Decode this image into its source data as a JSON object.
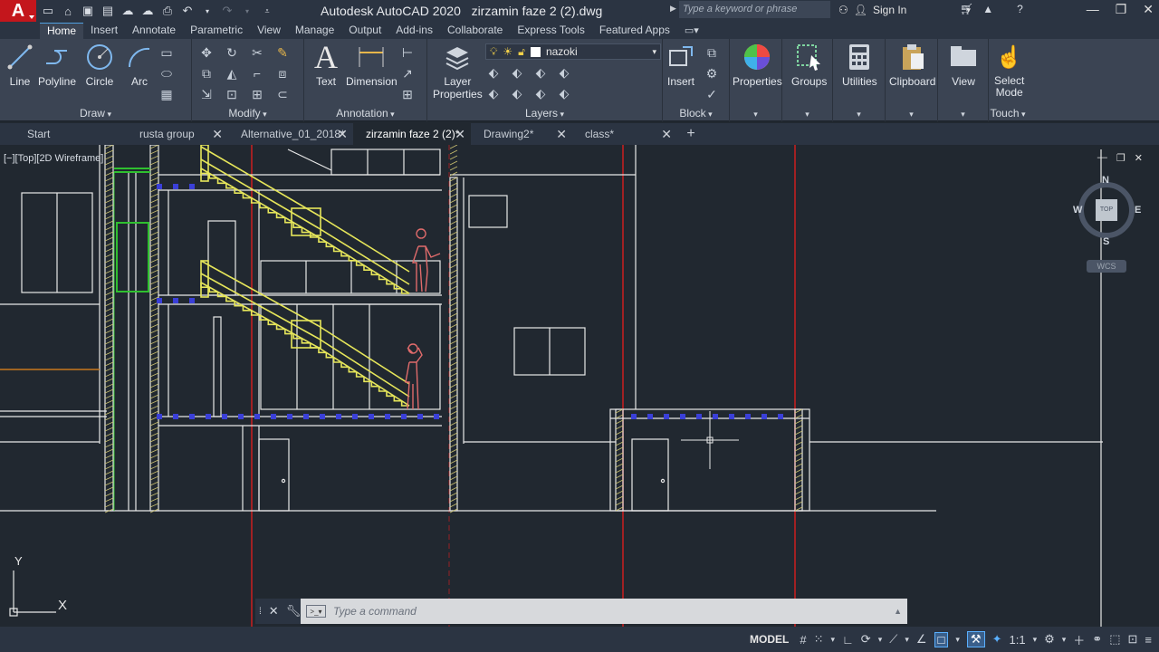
{
  "app": {
    "logo_letter": "A",
    "title": "Autodesk AutoCAD 2020",
    "filename": "zirzamin faze 2 (2).dwg",
    "search_placeholder": "Type a keyword or phrase",
    "sign_in": "Sign In"
  },
  "ribbon_tabs": [
    "Home",
    "Insert",
    "Annotate",
    "Parametric",
    "View",
    "Manage",
    "Output",
    "Add-ins",
    "Collaborate",
    "Express Tools",
    "Featured Apps"
  ],
  "ribbon": {
    "draw": {
      "title": "Draw",
      "line": "Line",
      "polyline": "Polyline",
      "circle": "Circle",
      "arc": "Arc"
    },
    "modify": {
      "title": "Modify"
    },
    "annotation": {
      "title": "Annotation",
      "text": "Text",
      "dimension": "Dimension"
    },
    "layers": {
      "title": "Layers",
      "layer_properties_1": "Layer",
      "layer_properties_2": "Properties",
      "current_layer": "nazoki"
    },
    "block": {
      "title": "Block",
      "insert": "Insert"
    },
    "properties": "Properties",
    "groups": "Groups",
    "utilities": "Utilities",
    "clipboard": "Clipboard",
    "view": "View",
    "select_mode_1": "Select",
    "select_mode_2": "Mode",
    "touch": "Touch"
  },
  "file_tabs": [
    {
      "label": "Start",
      "closable": false,
      "active": false
    },
    {
      "label": "rusta group",
      "closable": true,
      "active": false
    },
    {
      "label": "Alternative_01_2018*",
      "closable": true,
      "active": false
    },
    {
      "label": "zirzamin faze 2 (2)*",
      "closable": true,
      "active": true
    },
    {
      "label": "Drawing2*",
      "closable": true,
      "active": false
    },
    {
      "label": "class*",
      "closable": true,
      "active": false
    }
  ],
  "viewport": {
    "label": "[−][Top][2D Wireframe]",
    "viewcube": {
      "n": "N",
      "s": "S",
      "e": "E",
      "w": "W",
      "face": "TOP",
      "wcs": "WCS"
    },
    "ucs_x": "X",
    "ucs_y": "Y"
  },
  "command": {
    "placeholder": "Type a command"
  },
  "status": {
    "model": "MODEL",
    "scale": "1:1"
  },
  "colors": {
    "stairs": "#e6e65a",
    "figures": "#e06b6b",
    "red_lines": "#cc1f1f",
    "blue_dots": "#3a3fd8",
    "green": "#2fc02f",
    "walls": "#e8e8e8",
    "orange_line": "#c7781e"
  }
}
